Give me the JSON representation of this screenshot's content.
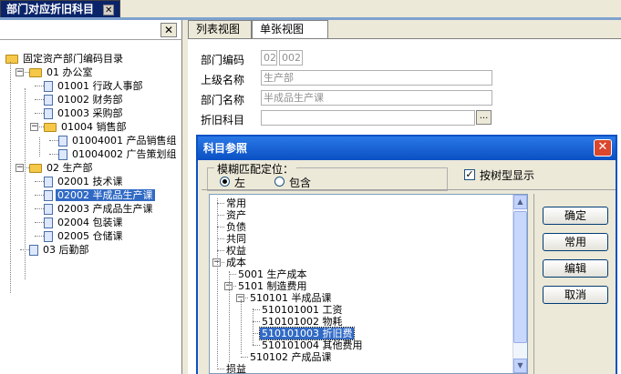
{
  "doc_tab": {
    "title": "部门对应折旧科目",
    "close": "✕"
  },
  "left_panel": {
    "close": "✕",
    "tree": [
      {
        "label": "固定资产部门编码目录",
        "level": 0,
        "kind": "folder",
        "expander": ""
      },
      {
        "label": "01  办公室",
        "level": 1,
        "kind": "folder",
        "expander": "−"
      },
      {
        "label": "01001  行政人事部",
        "level": 2,
        "kind": "doc"
      },
      {
        "label": "01002  财务部",
        "level": 2,
        "kind": "doc"
      },
      {
        "label": "01003  采购部",
        "level": 2,
        "kind": "doc"
      },
      {
        "label": "01004  销售部",
        "level": 2,
        "kind": "folder",
        "expander": "−"
      },
      {
        "label": "01004001  产品销售组",
        "level": 3,
        "kind": "doc"
      },
      {
        "label": "01004002  广告策划组",
        "level": 3,
        "kind": "doc"
      },
      {
        "label": "02  生产部",
        "level": 1,
        "kind": "folder",
        "expander": "−"
      },
      {
        "label": "02001  技术课",
        "level": 2,
        "kind": "doc"
      },
      {
        "label": "02002  半成品生产课",
        "level": 2,
        "kind": "doc",
        "selected": true
      },
      {
        "label": "02003  产成品生产课",
        "level": 2,
        "kind": "doc"
      },
      {
        "label": "02004  包装课",
        "level": 2,
        "kind": "doc"
      },
      {
        "label": "02005  仓储课",
        "level": 2,
        "kind": "doc"
      },
      {
        "label": "03  后勤部",
        "level": 1,
        "kind": "doc"
      }
    ]
  },
  "right_tabs": [
    {
      "label": "列表视图",
      "active": false
    },
    {
      "label": "单张视图",
      "active": true
    }
  ],
  "form": {
    "dept_code_label": "部门编码",
    "dept_code_part1": "02",
    "dept_code_part2": "002",
    "parent_name_label": "上级名称",
    "parent_name_value": "生产部",
    "dept_name_label": "部门名称",
    "dept_name_value": "半成品生产课",
    "depr_account_label": "折旧科目",
    "depr_account_value": "",
    "ellipsis": "..."
  },
  "dialog": {
    "title": "科目参照",
    "close": "✕",
    "fuzzy_group_label": "模糊匹配定位：",
    "radio_left": "左",
    "radio_contains": "包含",
    "radio_selected": "左",
    "tree_display_label": "按树型显示",
    "tree_display_checked": true,
    "tree": [
      {
        "label": "常用",
        "level": 0
      },
      {
        "label": "资产",
        "level": 0
      },
      {
        "label": "负债",
        "level": 0
      },
      {
        "label": "共同",
        "level": 0
      },
      {
        "label": "权益",
        "level": 0
      },
      {
        "label": "成本",
        "level": 0,
        "expander": "−"
      },
      {
        "label": "5001  生产成本",
        "level": 1
      },
      {
        "label": "5101  制造费用",
        "level": 1,
        "expander": "−"
      },
      {
        "label": "510101  半成品课",
        "level": 2,
        "expander": "−"
      },
      {
        "label": "510101001  工资",
        "level": 3
      },
      {
        "label": "510101002  物耗",
        "level": 3
      },
      {
        "label": "510101003  折旧费",
        "level": 3,
        "selected": true
      },
      {
        "label": "510101004  其他费用",
        "level": 3
      },
      {
        "label": "510102  产成品课",
        "level": 2
      },
      {
        "label": "损益",
        "level": 0
      }
    ],
    "buttons": {
      "ok": "确定",
      "common": "常用",
      "edit": "编辑",
      "cancel": "取消"
    }
  }
}
